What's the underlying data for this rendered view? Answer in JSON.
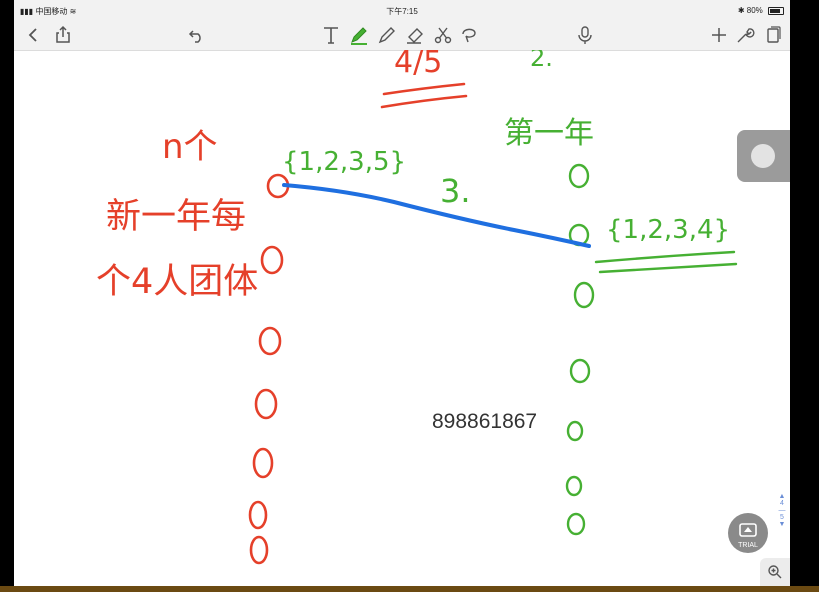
{
  "status_bar": {
    "carrier": "中国移动",
    "time": "下午7:15",
    "battery": "80%"
  },
  "toolbar": {
    "left_tools": [
      "back-icon",
      "share-icon",
      "undo-icon"
    ],
    "drawing_tools": [
      "text-tool-icon",
      "pen-tool-icon",
      "highlighter-tool-icon",
      "eraser-tool-icon",
      "scissors-tool-icon",
      "lasso-tool-icon"
    ],
    "right_tools": [
      "microphone-icon",
      "add-icon",
      "wrench-icon",
      "pages-icon"
    ]
  },
  "note": {
    "top_fragment_red": "4/5",
    "top_fragment_green": "2.",
    "left_title": "n个",
    "left_line2": "新一年每",
    "left_line3": "个4人团体",
    "set_left": "{1,2,3,5}",
    "middle_number": "3.",
    "right_title": "第一年",
    "set_right": "{1,2,3,4}"
  },
  "watermark": "898861867",
  "page_nav": {
    "current": "4",
    "total": "5"
  },
  "trial_badge": "TRIAL"
}
